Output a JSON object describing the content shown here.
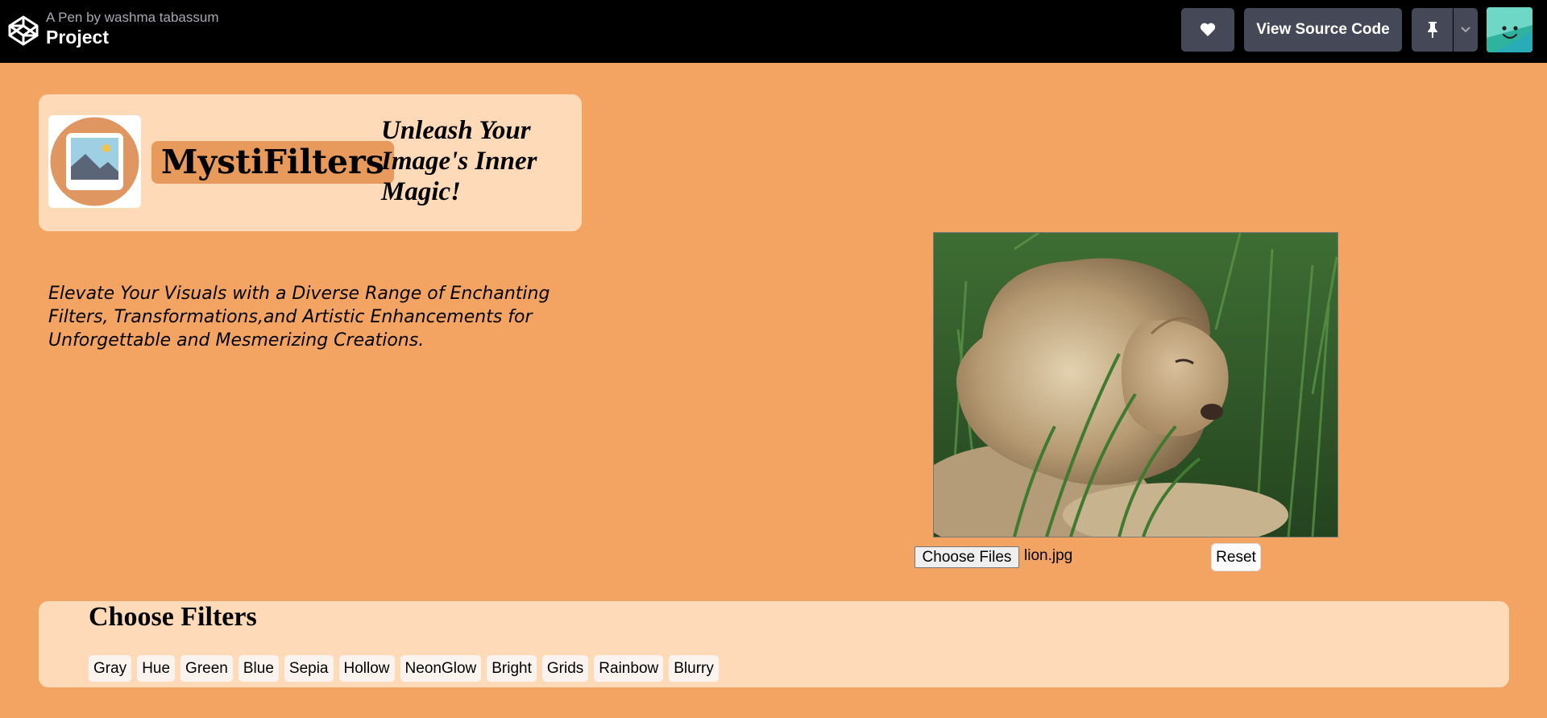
{
  "topbar": {
    "pen_by": "A Pen by washma tabassum",
    "title": "Project",
    "view_source_label": "View Source Code",
    "icons": [
      "codepen-logo-icon",
      "heart-icon",
      "pin-icon",
      "chevron-down-icon",
      "user-avatar"
    ]
  },
  "hero": {
    "brand": "MystiFilters",
    "tagline": "Unleash Your Image's Inner Magic!",
    "description": "Elevate Your Visuals with a Diverse Range of Enchanting Filters, Transformations,and Artistic Enhancements for Unforgettable and Mesmerizing Creations."
  },
  "upload": {
    "choose_label": "Choose Files",
    "file_name": "lion.jpg",
    "reset_label": "Reset"
  },
  "filters": {
    "title": "Choose Filters",
    "items": [
      "Gray",
      "Hue",
      "Green",
      "Blue",
      "Sepia",
      "Hollow",
      "NeonGlow",
      "Bright",
      "Grids",
      "Rainbow",
      "Blurry"
    ]
  },
  "colors": {
    "page_bg": "#f4a462",
    "card_bg": "#fedab8",
    "brand_bg": "#e89a5d",
    "topbar_bg": "#000000",
    "topbar_button": "#444857"
  }
}
